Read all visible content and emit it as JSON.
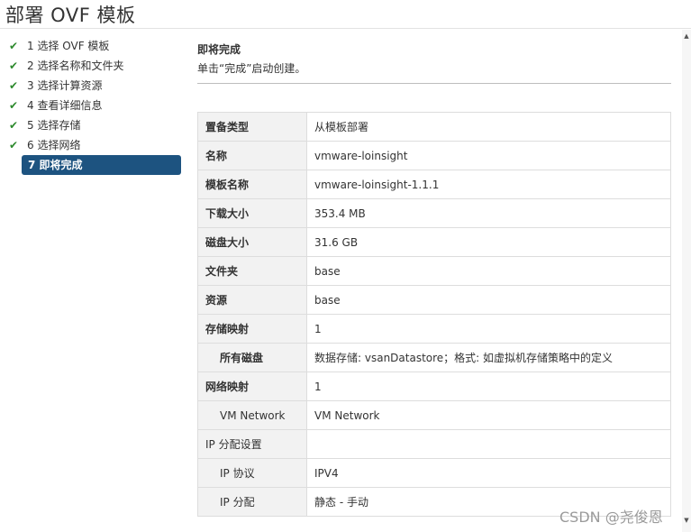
{
  "window": {
    "title": "部署 OVF 模板"
  },
  "steps": [
    {
      "label": "1 选择 OVF 模板",
      "done": true
    },
    {
      "label": "2 选择名称和文件夹",
      "done": true
    },
    {
      "label": "3 选择计算资源",
      "done": true
    },
    {
      "label": "4 查看详细信息",
      "done": true
    },
    {
      "label": "5 选择存储",
      "done": true
    },
    {
      "label": "6 选择网络",
      "done": true
    },
    {
      "label": "7 即将完成",
      "done": false,
      "active": true
    }
  ],
  "content": {
    "heading": "即将完成",
    "subheading": "单击“完成”启动创建。"
  },
  "summary": {
    "rows": [
      {
        "label": "置备类型",
        "value": "从模板部署"
      },
      {
        "label": "名称",
        "value": "vmware-loinsight"
      },
      {
        "label": "模板名称",
        "value": "vmware-loinsight-1.1.1"
      },
      {
        "label": "下载大小",
        "value": "353.4 MB"
      },
      {
        "label": "磁盘大小",
        "value": "31.6 GB"
      },
      {
        "label": "文件夹",
        "value": "base"
      },
      {
        "label": "资源",
        "value": "base"
      },
      {
        "label": "存储映射",
        "value": "1"
      },
      {
        "label": "所有磁盘",
        "value": "数据存储: vsanDatastore；格式: 如虚拟机存储策略中的定义"
      },
      {
        "label": "网络映射",
        "value": "1"
      },
      {
        "label": "VM Network",
        "value": "VM Network"
      },
      {
        "label": "IP 分配设置",
        "value": ""
      },
      {
        "label": "IP 协议",
        "value": "IPV4"
      },
      {
        "label": "IP 分配",
        "value": "静态 - 手动"
      }
    ]
  },
  "watermark": "CSDN @尧俊恩",
  "icons": {
    "step_done": "checkmark-icon",
    "scroll_up": "arrow-up-icon",
    "scroll_down": "arrow-down-icon"
  },
  "colors": {
    "active_step": "#1d5380",
    "check": "#2e8a2e"
  }
}
